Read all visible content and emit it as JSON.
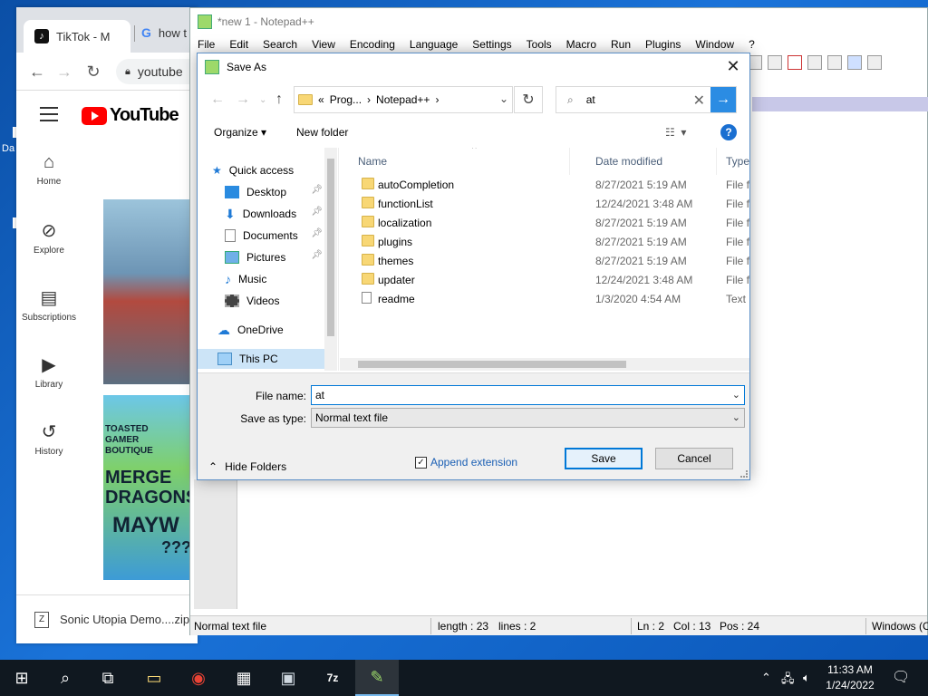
{
  "desktop": {
    "icon_label": "Da"
  },
  "chrome": {
    "tab1_title": "TikTok - M",
    "tab2_title": "how t",
    "omnibox_text": "youtube",
    "yt_wordmark": "YouTube",
    "sidebar": [
      {
        "label": "Home",
        "icon": "⌂"
      },
      {
        "label": "Explore",
        "icon": "⊘"
      },
      {
        "label": "Subscriptions",
        "icon": "▤"
      },
      {
        "label": "Library",
        "icon": "▶"
      },
      {
        "label": "History",
        "icon": "↺"
      }
    ],
    "thumb2_text": [
      "TOASTED",
      "GAMER",
      "BOUTIQUE",
      "MERGE",
      "DRAGONS",
      "MAYW",
      "???"
    ],
    "download_name": "Sonic Utopia Demo....zip"
  },
  "notepad": {
    "title": "*new 1 - Notepad++",
    "menu": [
      "File",
      "Edit",
      "Search",
      "View",
      "Encoding",
      "Language",
      "Settings",
      "Tools",
      "Macro",
      "Run",
      "Plugins",
      "Window",
      "?"
    ],
    "status": {
      "filetype": "Normal text file",
      "length": "length : 23",
      "lines": "lines : 2",
      "ln": "Ln : 2",
      "col": "Col : 13",
      "pos": "Pos : 24",
      "eol": "Windows (C"
    }
  },
  "dialog": {
    "title": "Save As",
    "address": {
      "prefix": "«",
      "segment1": "Prog...",
      "segment2": "Notepad++"
    },
    "search_value": "at",
    "organize_label": "Organize",
    "new_folder_label": "New folder",
    "nav": [
      {
        "label": "Quick access",
        "pinned": false
      },
      {
        "label": "Desktop",
        "pinned": true
      },
      {
        "label": "Downloads",
        "pinned": true
      },
      {
        "label": "Documents",
        "pinned": true
      },
      {
        "label": "Pictures",
        "pinned": true
      },
      {
        "label": "Music",
        "pinned": false
      },
      {
        "label": "Videos",
        "pinned": false
      },
      {
        "label": "OneDrive",
        "pinned": false
      },
      {
        "label": "This PC",
        "pinned": false
      }
    ],
    "columns": {
      "name": "Name",
      "date": "Date modified",
      "type": "Type"
    },
    "files": [
      {
        "name": "autoCompletion",
        "date": "8/27/2021 5:19 AM",
        "type": "File fo",
        "kind": "folder"
      },
      {
        "name": "functionList",
        "date": "12/24/2021 3:48 AM",
        "type": "File fo",
        "kind": "folder"
      },
      {
        "name": "localization",
        "date": "8/27/2021 5:19 AM",
        "type": "File fo",
        "kind": "folder"
      },
      {
        "name": "plugins",
        "date": "8/27/2021 5:19 AM",
        "type": "File fo",
        "kind": "folder"
      },
      {
        "name": "themes",
        "date": "8/27/2021 5:19 AM",
        "type": "File fo",
        "kind": "folder"
      },
      {
        "name": "updater",
        "date": "12/24/2021 3:48 AM",
        "type": "File fo",
        "kind": "folder"
      },
      {
        "name": "readme",
        "date": "1/3/2020 4:54 AM",
        "type": "Text D",
        "kind": "file"
      }
    ],
    "file_name_label": "File name:",
    "file_name_value": "at",
    "save_type_label": "Save as type:",
    "save_type_value": "Normal text file",
    "hide_folders_label": "Hide Folders",
    "append_extension_label": "Append extension",
    "append_extension_checked": true,
    "save_label": "Save",
    "cancel_label": "Cancel"
  },
  "taskbar": {
    "time": "11:33 AM",
    "date": "1/24/2022"
  },
  "colors": {
    "accent": "#0078d7",
    "folder": "#f8d775",
    "selection": "#cce4f7",
    "youtube_red": "#ff0000",
    "taskbar": "#101820"
  }
}
